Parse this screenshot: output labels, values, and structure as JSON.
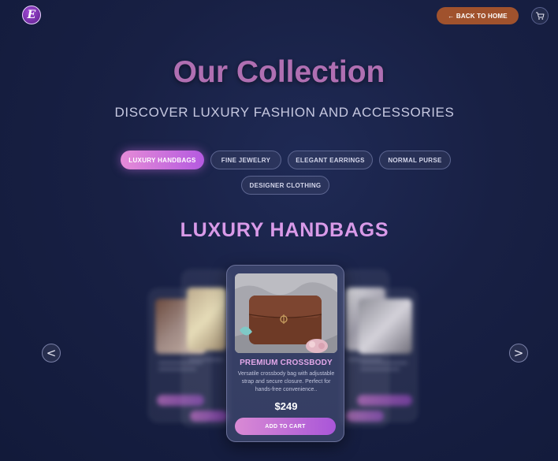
{
  "header": {
    "logo_letter": "E",
    "back_label": "← BACK TO HOME"
  },
  "page": {
    "title": "Our Collection",
    "subtitle": "DISCOVER LUXURY FASHION AND ACCESSORIES"
  },
  "categories": [
    {
      "label": "LUXURY HANDBAGS",
      "active": true
    },
    {
      "label": "FINE JEWELRY",
      "active": false
    },
    {
      "label": "ELEGANT EARRINGS",
      "active": false
    },
    {
      "label": "NORMAL PURSE",
      "active": false
    },
    {
      "label": "DESIGNER CLOTHING",
      "active": false
    }
  ],
  "section": {
    "title": "LUXURY HANDBAGS"
  },
  "carousel": {
    "prev_label": "<",
    "next_label": ">",
    "active_product": {
      "name": "PREMIUM CROSSBODY",
      "description": "Versatile crossbody bag with adjustable strap and secure closure. Perfect for hands-free convenience..",
      "price": "$249",
      "button_label": "ADD TO CART"
    }
  },
  "colors": {
    "accent_pink": "#d98ad4",
    "accent_purple": "#a956d8",
    "back_button": "#a0522d",
    "title": "#b06fb2"
  },
  "icons": {
    "logo": "logo-icon",
    "cart": "cart-icon",
    "prev": "chevron-left-icon",
    "next": "chevron-right-icon"
  }
}
